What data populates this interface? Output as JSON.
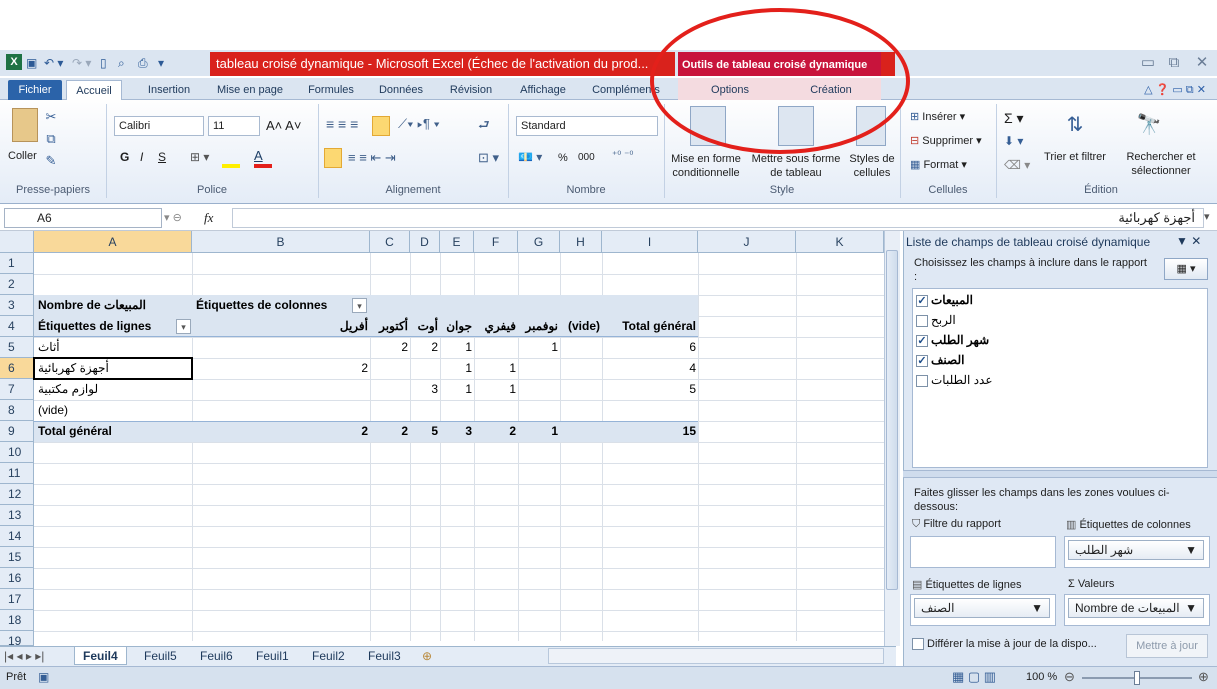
{
  "window": {
    "title": "tableau croisé dynamique - Microsoft Excel (Échec de l'activation du prod...",
    "context_title": "Outils de tableau croisé dynamique"
  },
  "tabs": [
    "Fichier",
    "Accueil",
    "Insertion",
    "Mise en page",
    "Formules",
    "Données",
    "Révision",
    "Affichage",
    "Compléments"
  ],
  "context_tabs": [
    "Options",
    "Création"
  ],
  "ribbon": {
    "clipboard": {
      "paste": "Coller",
      "label": "Presse-papiers"
    },
    "font": {
      "name": "Calibri",
      "size": "11",
      "label": "Police",
      "bold": "G",
      "italic": "I",
      "underline": "S"
    },
    "alignment": {
      "label": "Alignement"
    },
    "number": {
      "format": "Standard",
      "label": "Nombre",
      "percent": "%",
      "thousands": "000"
    },
    "style": {
      "cond": "Mise en forme conditionnelle",
      "table": "Mettre sous forme de tableau",
      "cellstyles": "Styles de cellules",
      "label": "Style"
    },
    "cells": {
      "insert": "Insérer",
      "delete": "Supprimer",
      "format": "Format",
      "label": "Cellules"
    },
    "edit": {
      "sort": "Trier et filtrer",
      "find": "Rechercher et sélectionner",
      "label": "Édition",
      "sigma": "Σ"
    }
  },
  "formula_bar": {
    "name_box": "A6",
    "fx": "fx",
    "value": "أجهزة كهربائية"
  },
  "columns": [
    "A",
    "B",
    "C",
    "D",
    "E",
    "F",
    "G",
    "H",
    "I",
    "J",
    "K"
  ],
  "rows": [
    "1",
    "2",
    "3",
    "4",
    "5",
    "6",
    "7",
    "8",
    "9",
    "10",
    "11",
    "12",
    "13",
    "14",
    "15",
    "16",
    "17",
    "18",
    "19"
  ],
  "pivot": {
    "a3": "Nombre de المبيعات",
    "b3": "Étiquettes de colonnes",
    "a4": "Étiquettes de lignes",
    "col_headers": [
      "أفريل",
      "أكتوبر",
      "أوت",
      "جوان",
      "فيفري",
      "نوفمبر",
      "(vide)",
      "Total général"
    ],
    "rows": [
      {
        "label": "أثاث",
        "vals": [
          "",
          "2",
          "2",
          "1",
          "",
          "1",
          "",
          "6"
        ]
      },
      {
        "label": "أجهزة كهربائية",
        "vals": [
          "2",
          "",
          "",
          "1",
          "1",
          "",
          "",
          "4"
        ]
      },
      {
        "label": "لوازم مكتبية",
        "vals": [
          "",
          "",
          "3",
          "1",
          "1",
          "",
          "",
          "5"
        ]
      },
      {
        "label": "(vide)",
        "vals": [
          "",
          "",
          "",
          "",
          "",
          "",
          "",
          ""
        ]
      }
    ],
    "total": {
      "label": "Total général",
      "vals": [
        "2",
        "2",
        "5",
        "3",
        "2",
        "1",
        "",
        "15"
      ]
    }
  },
  "sheets": [
    "Feuil4",
    "Feuil5",
    "Feuil6",
    "Feuil1",
    "Feuil2",
    "Feuil3"
  ],
  "status": {
    "ready": "Prêt",
    "zoom": "100 %"
  },
  "pane": {
    "title": "Liste de champs de tableau croisé dynamique",
    "choose": "Choisissez les champs à inclure dans le rapport :",
    "fields": [
      {
        "name": "المبيعات",
        "checked": true,
        "bold": true
      },
      {
        "name": "الربح",
        "checked": false,
        "bold": false
      },
      {
        "name": "شهر الطلب",
        "checked": true,
        "bold": true
      },
      {
        "name": "الصنف",
        "checked": true,
        "bold": true
      },
      {
        "name": "عدد الطلبات",
        "checked": false,
        "bold": false
      }
    ],
    "drag": "Faites glisser les champs dans les zones voulues ci-dessous:",
    "zone_filter": "Filtre du rapport",
    "zone_cols": "Étiquettes de colonnes",
    "zone_rows": "Étiquettes de lignes",
    "zone_values": "Valeurs",
    "cols_item": "شهر الطلب",
    "rows_item": "الصنف",
    "values_item": "Nombre de المبيعات",
    "defer": "Différer la mise à jour de la dispo...",
    "update": "Mettre à jour"
  },
  "colors": {
    "title_red": "#d9221c",
    "context": "#c8143c",
    "annotation_circle": "#e3201b"
  }
}
